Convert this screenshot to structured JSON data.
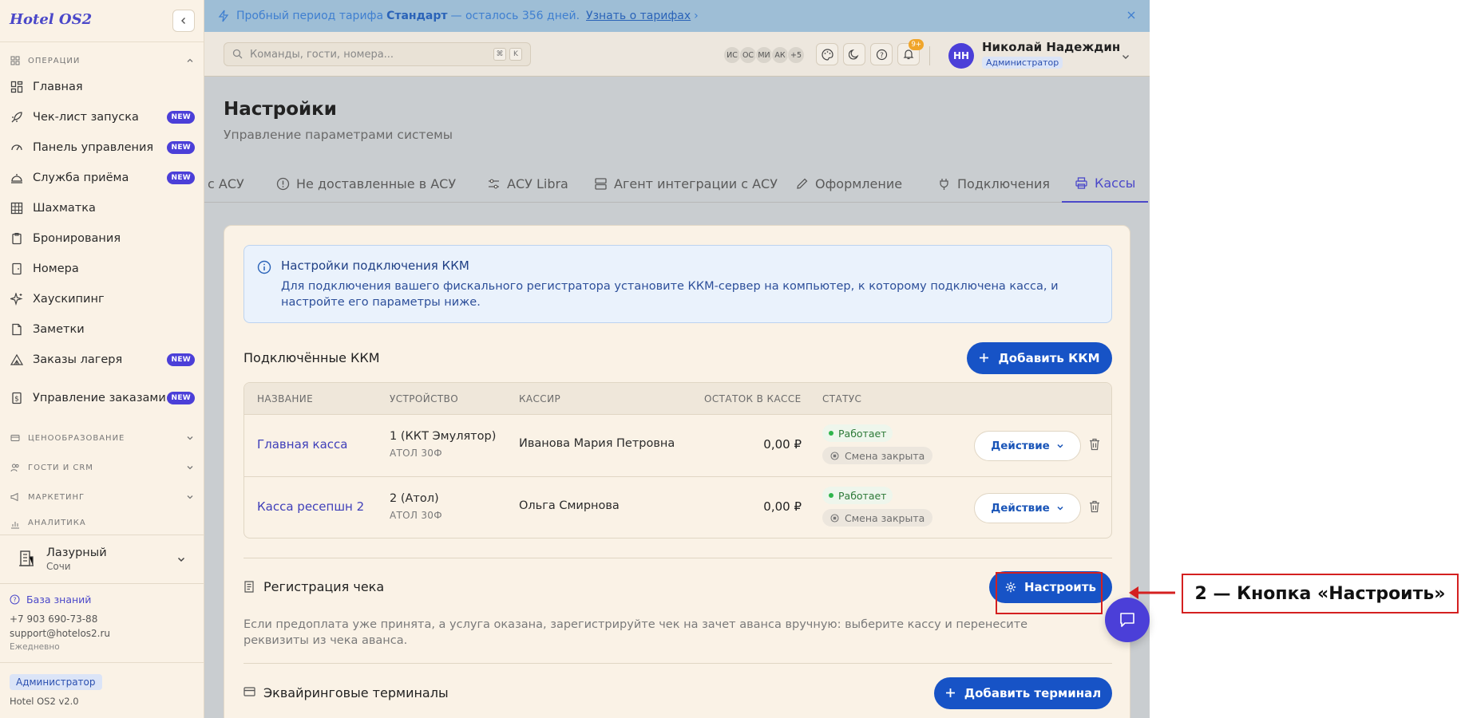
{
  "sidebar": {
    "brand": "Hotel OS2",
    "sections": {
      "operations": "ОПЕРАЦИИ",
      "pricing": "ЦЕНООБРАЗОВАНИЕ",
      "guests": "ГОСТИ И CRM",
      "marketing": "МАРКЕТИНГ",
      "analytics": "АНАЛИТИКА"
    },
    "items": [
      {
        "label": "Главная",
        "icon": "dashboard-grid-icon",
        "badge": ""
      },
      {
        "label": "Чек-лист запуска",
        "icon": "rocket-icon",
        "badge": "NEW"
      },
      {
        "label": "Панель управления",
        "icon": "gauge-icon",
        "badge": "NEW"
      },
      {
        "label": "Служба приёма",
        "icon": "bell-service-icon",
        "badge": "NEW"
      },
      {
        "label": "Шахматка",
        "icon": "table-grid-icon",
        "badge": ""
      },
      {
        "label": "Бронирования",
        "icon": "clipboard-icon",
        "badge": ""
      },
      {
        "label": "Номера",
        "icon": "door-icon",
        "badge": ""
      },
      {
        "label": "Хаускипинг",
        "icon": "sparkles-icon",
        "badge": ""
      },
      {
        "label": "Заметки",
        "icon": "note-icon",
        "badge": ""
      },
      {
        "label": "Заказы лагеря",
        "icon": "tent-icon",
        "badge": "NEW"
      },
      {
        "label": "Управление заказами",
        "icon": "dollar-receipt-icon",
        "badge": "NEW"
      }
    ],
    "hotel": {
      "name": "Лазурный",
      "city": "Сочи"
    },
    "help": {
      "knowledge_base": "База знаний",
      "phone": "+7 903 690-73-88",
      "email": "support@hotelos2.ru",
      "schedule": "Ежедневно"
    },
    "role": "Администратор",
    "version": "Hotel OS2 v2.0"
  },
  "banner": {
    "prefix": "Пробный период тарифа",
    "plan": "Стандарт",
    "suffix": "— осталось 356 дней.",
    "link": "Узнать о тарифах",
    "arrow": "›"
  },
  "topbar": {
    "search_placeholder": "Команды, гости, номера...",
    "kbd_mod": "⌘",
    "kbd_key": "K",
    "avatars": [
      "ИС",
      "ОС",
      "МИ",
      "АК",
      "+5"
    ],
    "notifications_count": "9+",
    "user": {
      "initials": "НН",
      "name": "Николай Надеждин",
      "role": "Администратор"
    }
  },
  "page": {
    "title": "Настройки",
    "subtitle": "Управление параметрами системы"
  },
  "tabs": [
    {
      "label": "с АСУ",
      "icon": ""
    },
    {
      "label": "Не доставленные в АСУ",
      "icon": "alert-circle-icon"
    },
    {
      "label": "АСУ Libra",
      "icon": "sliders-icon"
    },
    {
      "label": "Агент интеграции с АСУ",
      "icon": "server-icon"
    },
    {
      "label": "Оформление",
      "icon": "pencil-icon"
    },
    {
      "label": "Подключения",
      "icon": "plug-icon"
    },
    {
      "label": "Кассы",
      "icon": "printer-icon"
    }
  ],
  "active_tab": "Кассы",
  "info": {
    "title": "Настройки подключения ККМ",
    "text": "Для подключения вашего фискального регистратора установите ККМ-сервер на компьютер, к которому подключена касса, и настройте его параметры ниже."
  },
  "kkm": {
    "title": "Подключённые ККМ",
    "add_button": "Добавить ККМ",
    "columns": [
      "НАЗВАНИЕ",
      "УСТРОЙСТВО",
      "КАССИР",
      "ОСТАТОК В КАССЕ",
      "СТАТУС"
    ],
    "rows": [
      {
        "name": "Главная касса",
        "device": "1 (ККТ Эмулятор)",
        "model": "АТОЛ 30Ф",
        "cashier": "Иванова Мария Петровна",
        "balance": "0,00 ₽",
        "status": "Работает",
        "shift": "Смена закрыта",
        "action": "Действие"
      },
      {
        "name": "Касса ресепшн 2",
        "device": "2 (Атол)",
        "model": "АТОЛ 30Ф",
        "cashier": "Ольга Смирнова",
        "balance": "0,00 ₽",
        "status": "Работает",
        "shift": "Смена закрыта",
        "action": "Действие"
      }
    ]
  },
  "receipt": {
    "title": "Регистрация чека",
    "button": "Настроить",
    "text": "Если предоплата уже принята, а услуга оказана, зарегистрируйте чек на зачет аванса вручную: выберите кассу и перенесите реквизиты из чека аванса."
  },
  "acquiring": {
    "title": "Эквайринговые терминалы",
    "add_button": "Добавить терминал"
  },
  "annotation": {
    "label": "2 — Кнопка «Настроить»"
  },
  "colors": {
    "accent": "#4b48c9",
    "primary_button": "#1753c6",
    "annotation": "#d42020",
    "status_ok": "#2fb54c"
  }
}
